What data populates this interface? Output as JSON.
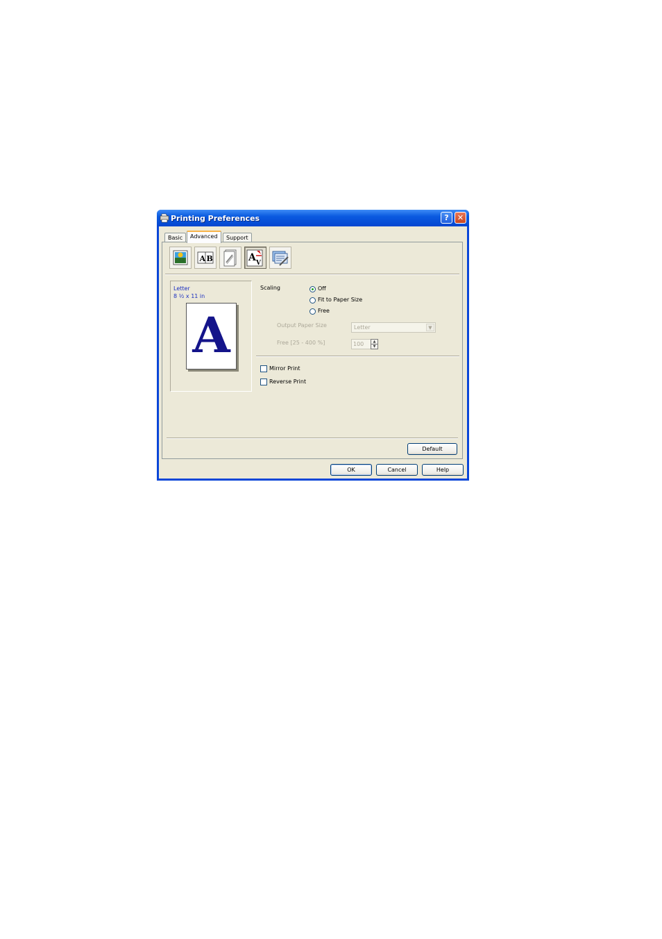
{
  "window": {
    "title": "Printing Preferences",
    "help_label": "?",
    "close_label": "✕"
  },
  "tabs": [
    {
      "label": "Basic"
    },
    {
      "label": "Advanced"
    },
    {
      "label": "Support"
    }
  ],
  "active_tab": "Advanced",
  "toolbar": {
    "items": [
      {
        "icon": "color-quality-icon"
      },
      {
        "icon": "ab-options-icon"
      },
      {
        "icon": "watermark-copy-icon"
      },
      {
        "icon": "scaling-page-icon",
        "selected": true
      },
      {
        "icon": "device-options-icon"
      }
    ]
  },
  "preview": {
    "paper_name": "Letter",
    "paper_size": "8 ½ x 11 in",
    "sample_letter": "A"
  },
  "scaling": {
    "label": "Scaling",
    "options": [
      {
        "label": "Off",
        "selected": true
      },
      {
        "label": "Fit to Paper Size",
        "selected": false
      },
      {
        "label": "Free",
        "selected": false
      }
    ],
    "output_paper_size_label": "Output Paper Size",
    "output_paper_size_value": "Letter",
    "free_range_label": "Free [25 - 400 %]",
    "free_value": "100"
  },
  "options": {
    "mirror_print": "Mirror Print",
    "reverse_print": "Reverse Print"
  },
  "buttons": {
    "default": "Default",
    "ok": "OK",
    "cancel": "Cancel",
    "help": "Help"
  },
  "colors": {
    "title_bar": "#0a5ae0",
    "dialog_background": "#ece9d8",
    "preview_text": "#1a2ec0",
    "preview_letter": "#14148a"
  }
}
